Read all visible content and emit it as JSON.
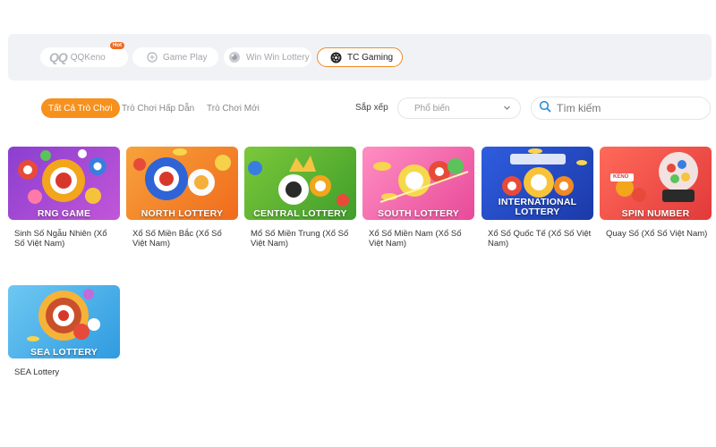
{
  "providers": [
    {
      "label": "QQKeno",
      "logo_text": "QQ",
      "badge": "Hot",
      "icon": "qq-logo"
    },
    {
      "label": "Game Play",
      "icon": "gameplay-icon"
    },
    {
      "label": "Win Win Lottery",
      "icon": "winwin-icon"
    },
    {
      "label": "TC Gaming",
      "icon": "tc-gaming-icon",
      "active": true
    }
  ],
  "filters": {
    "tabs": [
      "Tất Cả Trò Chơi",
      "Trò Chơi Hấp Dẫn",
      "Trò Chơi Mới"
    ],
    "active_tab": "Tất Cả Trò Chơi",
    "sort_label": "Sắp xếp",
    "sort_value": "Phổ biến",
    "search_placeholder": "Tìm kiếm"
  },
  "games": [
    {
      "banner": "RNG GAME",
      "title": "Sinh Số Ngẫu Nhiên (Xổ Số Việt Nam)"
    },
    {
      "banner": "NORTH LOTTERY",
      "title": "Xổ Số Miền Bắc (Xổ Số Việt Nam)"
    },
    {
      "banner": "CENTRAL LOTTERY",
      "title": "Mổ Số Miền Trung (Xổ Số Việt Nam)"
    },
    {
      "banner": "SOUTH LOTTERY",
      "title": "Xổ Số Miền Nam (Xổ Số Việt Nam)"
    },
    {
      "banner_line1": "INTERNATIONAL",
      "banner_line2": "LOTTERY",
      "title": "Xổ Số Quốc Tế (Xổ Số Việt Nam)"
    },
    {
      "banner": "SPIN NUMBER",
      "badge": "KENO",
      "title": "Quay Số (Xổ Số Việt Nam)"
    },
    {
      "banner": "SEA LOTTERY",
      "title": "SEA Lottery"
    }
  ],
  "colors": {
    "accent": "#f6911e",
    "active_border": "#f08a24",
    "search_icon": "#2b8fd6"
  }
}
